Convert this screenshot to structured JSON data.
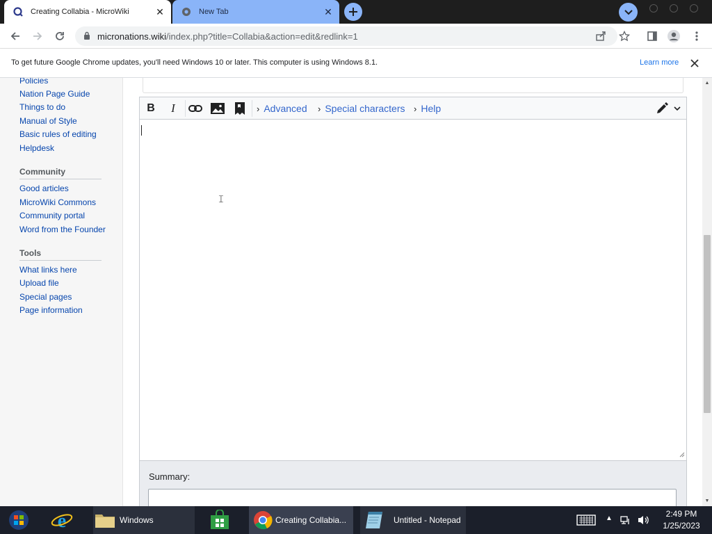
{
  "browser": {
    "tabs": [
      {
        "title": "Creating Collabia - MicroWiki",
        "close": "✕"
      },
      {
        "title": "New Tab",
        "close": "✕"
      }
    ],
    "url_host": "micronations.wiki",
    "url_path": "/index.php?title=Collabia&action=edit&redlink=1",
    "infobar": {
      "message": "To get future Google Chrome updates, you'll need Windows 10 or later. This computer is using Windows 8.1.",
      "learn_more": "Learn more",
      "close": "✕"
    },
    "colors": {
      "active_tab": "#ffffff",
      "inactive_tab": "#8ab4f8",
      "tabstrip": "#1e1e1e"
    }
  },
  "sidebar": {
    "navigation_items": [
      "Policies",
      "Nation Page Guide",
      "Things to do",
      "Manual of Style",
      "Basic rules of editing",
      "Helpdesk"
    ],
    "community": {
      "heading": "Community",
      "items": [
        "Good articles",
        "MicroWiki Commons",
        "Community portal",
        "Word from the Founder"
      ]
    },
    "tools": {
      "heading": "Tools",
      "items": [
        "What links here",
        "Upload file",
        "Special pages",
        "Page information"
      ]
    }
  },
  "editor": {
    "toolbar": {
      "bold": "B",
      "italic": "I",
      "advanced": "Advanced",
      "special_characters": "Special characters",
      "help": "Help",
      "chevron": "›"
    },
    "content": "",
    "summary_label": "Summary:"
  },
  "taskbar": {
    "items": [
      {
        "label": "Windows"
      },
      {
        "label": "Creating Collabia..."
      },
      {
        "label": "Untitled - Notepad"
      }
    ],
    "time": "2:49 PM",
    "date": "1/25/2023"
  }
}
